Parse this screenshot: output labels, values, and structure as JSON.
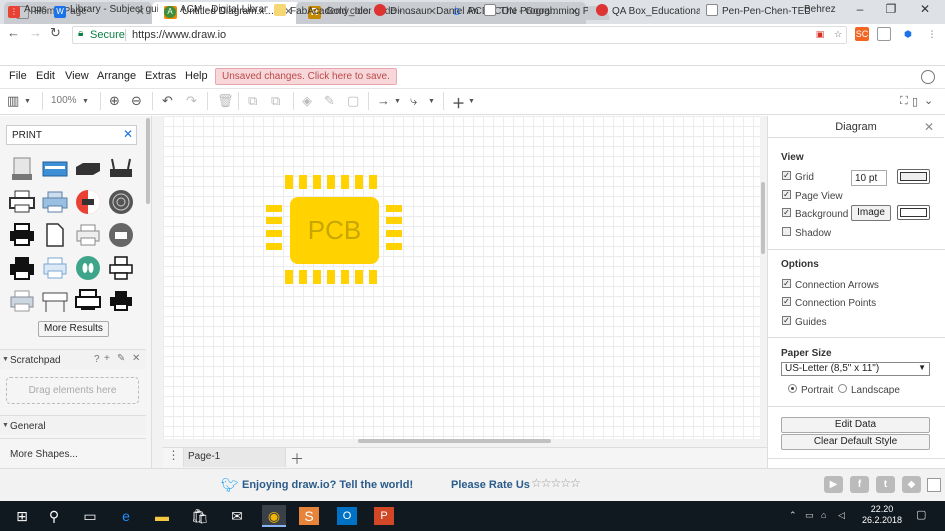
{
  "browser": {
    "tabs": [
      {
        "title": "Home Page",
        "active": false
      },
      {
        "title": "Untitled Diagram.xml - d",
        "active": true
      },
      {
        "title": "Gold color code - RGB g",
        "active": false
      },
      {
        "title": "PCB ICON - Google Sear",
        "active": false
      }
    ],
    "profile": "Behrez",
    "secure_label": "Secure",
    "url": "https://www.draw.io",
    "bookmarks": [
      "Apps",
      "Library - Subject guid",
      "ACM - Digital Library",
      "FabAcademy_Ideas",
      "Dinosaur- Daniel Am",
      "The Programming Pu",
      "QA Box_Educational",
      "Pen-Pen-Chen-TED-E"
    ]
  },
  "menu": [
    "File",
    "Edit",
    "View",
    "Arrange",
    "Extras",
    "Help"
  ],
  "unsaved_notice": "Unsaved changes. Click here to save.",
  "toolbar": {
    "zoom": "100%"
  },
  "left_panel": {
    "search_value": "PRINT",
    "more_results": "More Results",
    "scratchpad": "Scratchpad",
    "scratchpad_drop": "Drag elements here",
    "general": "General",
    "more_shapes": "More Shapes..."
  },
  "canvas": {
    "chip_label": "PCB",
    "chip_color": "#ffd200",
    "page_tab": "Page-1"
  },
  "right_panel": {
    "title": "Diagram",
    "view_heading": "View",
    "grid": "Grid",
    "grid_size": "10 pt",
    "page_view": "Page View",
    "background": "Background",
    "image_button": "Image",
    "shadow": "Shadow",
    "options_heading": "Options",
    "connection_arrows": "Connection Arrows",
    "connection_points": "Connection Points",
    "guides": "Guides",
    "paper_heading": "Paper Size",
    "paper_value": "US-Letter (8,5\" x 11\")",
    "portrait": "Portrait",
    "landscape": "Landscape",
    "edit_data": "Edit Data",
    "clear_style": "Clear Default Style"
  },
  "footer": {
    "enjoy": "Enjoying draw.io? Tell the world!",
    "rate": "Please Rate Us"
  },
  "taskbar": {
    "time": "22.20",
    "date": "26.2.2018"
  }
}
